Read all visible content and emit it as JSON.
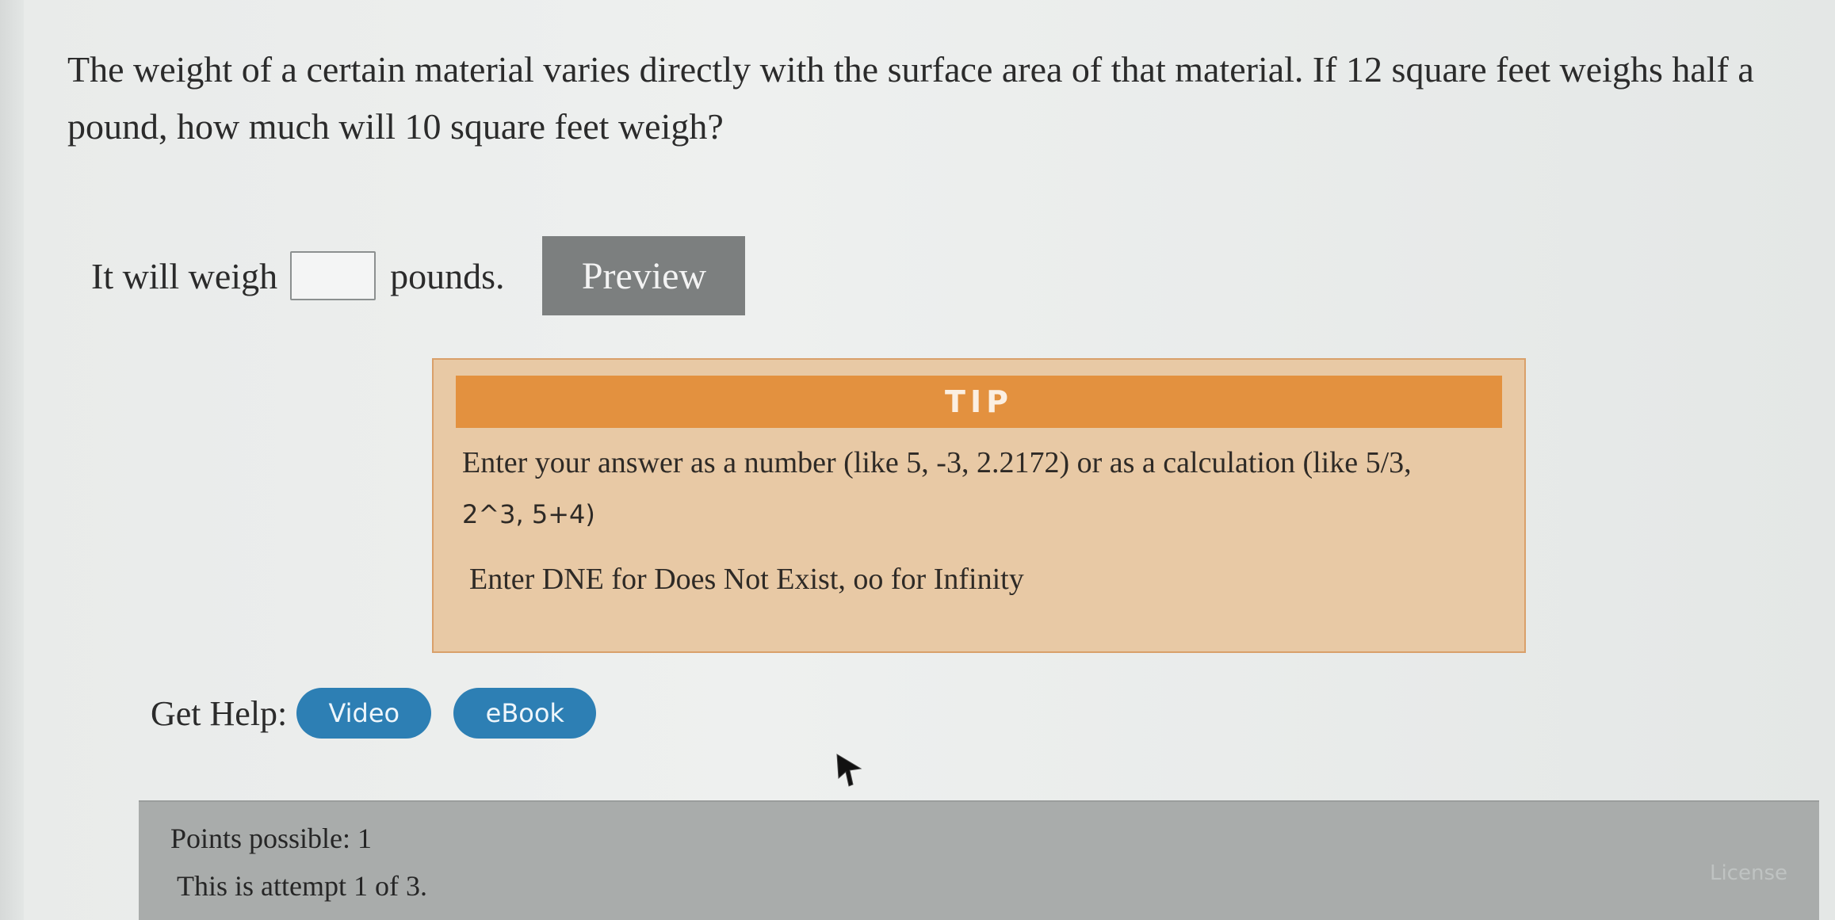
{
  "question": {
    "text": "The weight of a certain material varies directly with the surface area of that material. If 12 square feet weighs half a pound, how much will 10 square feet weigh?"
  },
  "answer": {
    "prefix": "It will weigh",
    "input_value": "",
    "suffix": "pounds.",
    "preview_label": "Preview"
  },
  "tip": {
    "header": "TIP",
    "line1": "Enter your answer as a number (like 5, -3, 2.2172) or as a calculation (like 5/3,",
    "line2": "2^3, 5+4)",
    "line3": "Enter DNE for Does Not Exist, oo for Infinity"
  },
  "help": {
    "label": "Get Help:",
    "video_label": "Video",
    "ebook_label": "eBook"
  },
  "footer": {
    "points": "Points possible: 1",
    "attempt": "This is attempt 1 of 3.",
    "link": "License"
  },
  "colors": {
    "tip_header": "#e3913f",
    "tip_body": "#e8c9a5",
    "help_pill": "#2d7fb4",
    "preview_button": "#7c7f7f",
    "footer_bg": "#a9acab"
  },
  "icons": {
    "cursor": "arrow-cursor-icon"
  }
}
